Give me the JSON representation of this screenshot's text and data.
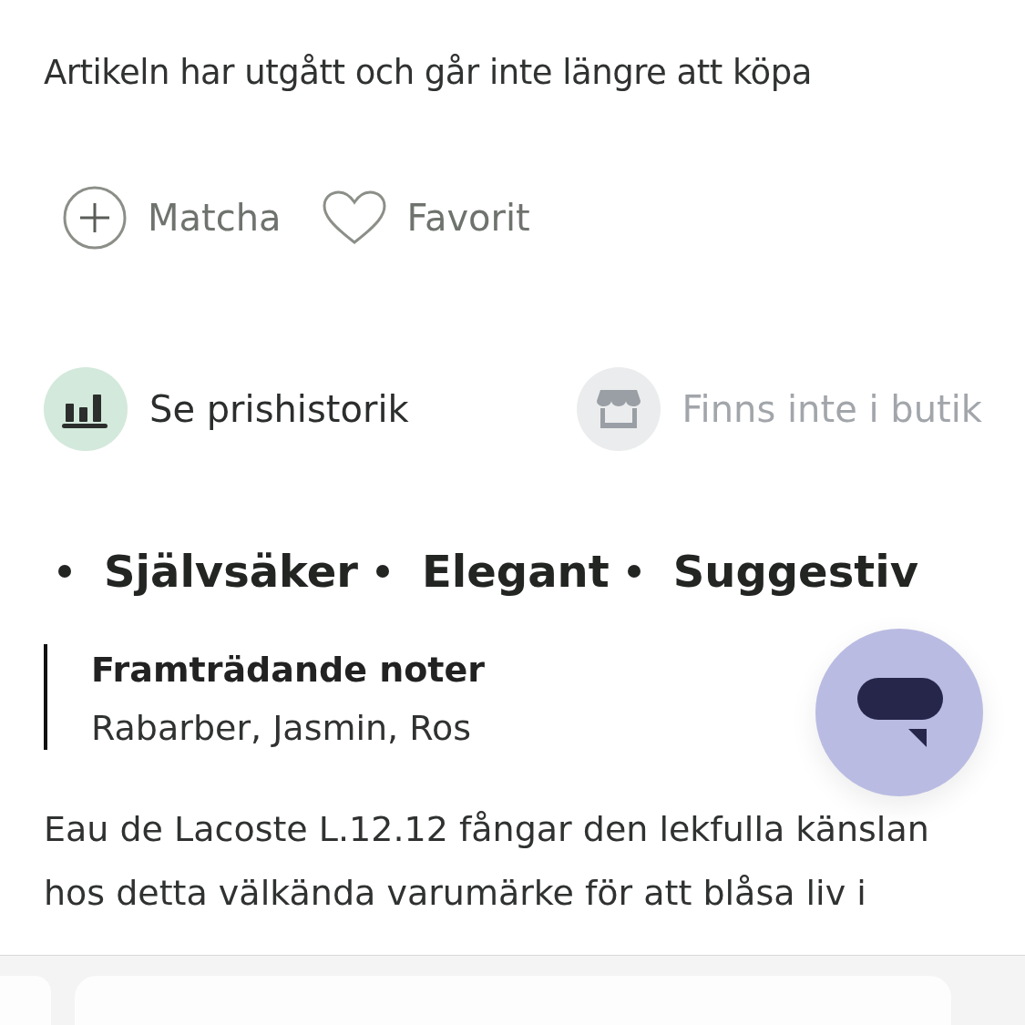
{
  "notice": "Artikeln har utgått och går inte längre att köpa",
  "quick_actions": [
    {
      "kind": "match",
      "label": "Matcha"
    },
    {
      "kind": "favorite",
      "label": "Favorit"
    }
  ],
  "info_actions": [
    {
      "kind": "price-history",
      "label": "Se prishistorik",
      "disabled": false
    },
    {
      "kind": "store",
      "label": "Finns inte i butik",
      "disabled": true
    }
  ],
  "tags": [
    "Självsäker",
    "Elegant",
    "Suggestiv"
  ],
  "notes": {
    "title": "Framträdande noter",
    "value": "Rabarber, Jasmin, Ros"
  },
  "description": "Eau de Lacoste L.12.12 fångar den lekfulla känslan hos detta välkända varumärke för att blåsa liv i"
}
